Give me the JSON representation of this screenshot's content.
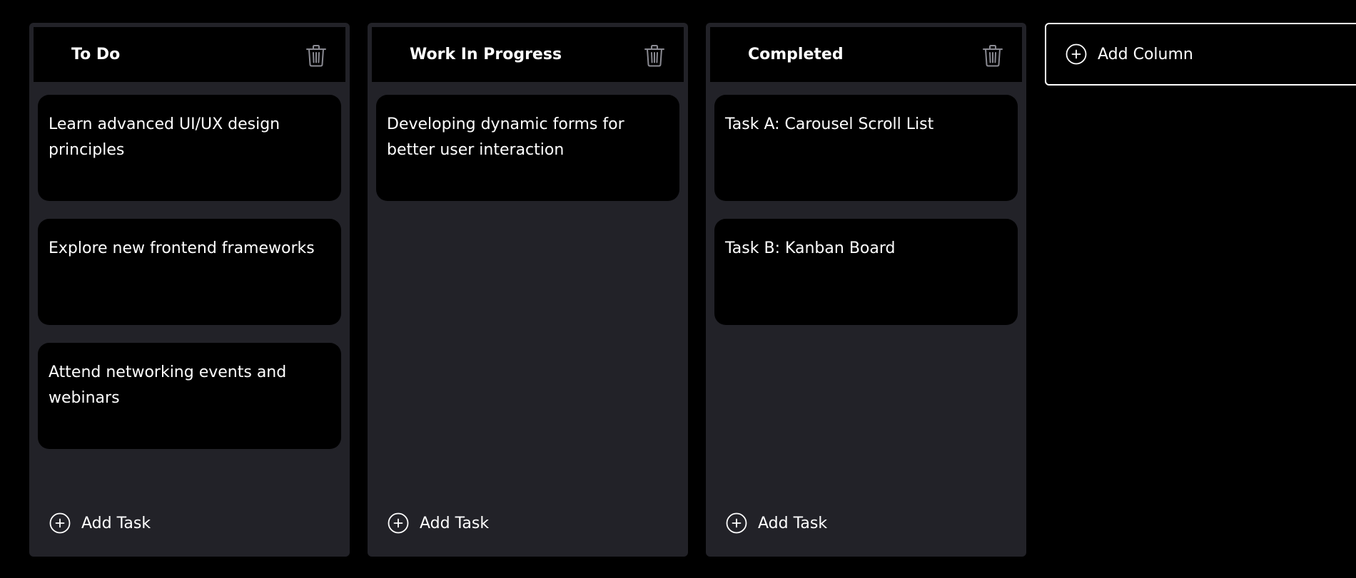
{
  "columns": [
    {
      "title": "To Do",
      "tasks": [
        "Learn advanced UI/UX design principles",
        "Explore new frontend frameworks",
        "Attend networking events and webinars"
      ],
      "add_task_label": "Add Task"
    },
    {
      "title": "Work In Progress",
      "tasks": [
        "Developing dynamic forms for better user interaction"
      ],
      "add_task_label": "Add Task"
    },
    {
      "title": "Completed",
      "tasks": [
        "Task A: Carousel Scroll List",
        "Task B: Kanban Board"
      ],
      "add_task_label": "Add Task"
    }
  ],
  "add_column_label": "Add Column",
  "icons": {
    "delete": "trash-icon",
    "add": "plus-circle-icon"
  },
  "colors": {
    "background": "#000000",
    "column": "#222228",
    "card": "#000000",
    "text": "#ffffff",
    "muted_icon": "#8a8a92"
  }
}
